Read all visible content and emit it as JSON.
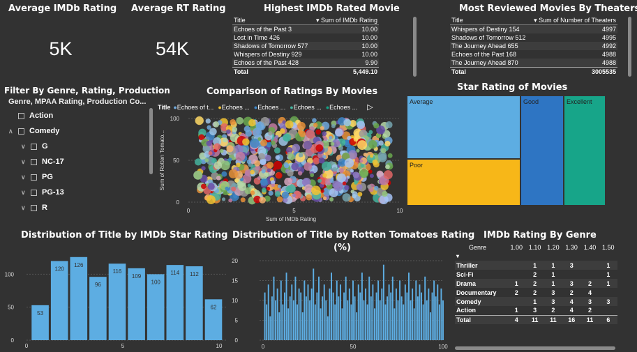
{
  "kpis": {
    "avg_imdb_label": "Average IMDb Rating",
    "avg_imdb_value": "5K",
    "avg_rt_label": "Average RT Rating",
    "avg_rt_value": "54K"
  },
  "highest_table": {
    "title": "Highest IMDb Rated Movie",
    "col_title": "Title",
    "col_value": "Sum of IMDb Rating",
    "rows": [
      [
        "Echoes of the Past 3",
        "10.00"
      ],
      [
        "Lost in Time 426",
        "10.00"
      ],
      [
        "Shadows of Tomorrow 577",
        "10.00"
      ],
      [
        "Whispers of Destiny 929",
        "10.00"
      ],
      [
        "Echoes of the Past 428",
        "9.90"
      ]
    ],
    "total_label": "Total",
    "total_value": "5,449.10"
  },
  "reviewed_table": {
    "title": "Most Reviewed Movies By Theaters",
    "col_title": "Title",
    "col_value": "Sum of Number of Theaters",
    "rows": [
      [
        "Whispers of Destiny 154",
        "4997"
      ],
      [
        "Shadows of Tomorrow 512",
        "4995"
      ],
      [
        "The Journey Ahead 655",
        "4992"
      ],
      [
        "Echoes of the Past 168",
        "4988"
      ],
      [
        "The Journey Ahead 870",
        "4988"
      ]
    ],
    "total_label": "Total",
    "total_value": "3005535"
  },
  "filter": {
    "title": "Filter By Genre, Rating, Production",
    "subtitle": "Genre, MPAA Rating, Production Co...",
    "items": [
      {
        "label": "Action",
        "level": 0
      },
      {
        "label": "Comedy",
        "level": 0
      },
      {
        "label": "G",
        "level": 1
      },
      {
        "label": "NC-17",
        "level": 1
      },
      {
        "label": "PG",
        "level": 1
      },
      {
        "label": "PG-13",
        "level": 1
      },
      {
        "label": "R",
        "level": 1
      }
    ]
  },
  "scatter": {
    "title": "Comparison of Ratings By Movies",
    "legend_label": "Title",
    "legend_items": [
      "Echoes of t...",
      "Echoes ...",
      "Echoes ...",
      "Echoes ...",
      "Echoes ..."
    ],
    "legend_colors": [
      "#6fa8dc",
      "#f1c232",
      "#3d85c6",
      "#45b39d",
      "#16a085"
    ],
    "xlabel": "Sum of IMDb Rating",
    "ylabel": "Sum of Rotten Tomato...",
    "xticks": [
      "0",
      "5",
      "10"
    ],
    "yticks": [
      "0",
      "50",
      "100"
    ]
  },
  "treemap": {
    "title": "Star Rating of Movies",
    "cells": [
      {
        "label": "Average",
        "color": "#5dade2"
      },
      {
        "label": "Poor",
        "color": "#f7b718"
      },
      {
        "label": "Good",
        "color": "#2e75c3"
      },
      {
        "label": "Excellent",
        "color": "#17a589"
      }
    ]
  },
  "imdb_dist": {
    "title": "Distribution of Title by IMDb Star Rating",
    "yticks": [
      "0",
      "50",
      "100"
    ],
    "xticks": [
      "0",
      "5",
      "10"
    ]
  },
  "rt_dist": {
    "title": "Distribution of Title by Rotten Tomatoes Rating",
    "title2": "(%)",
    "yticks": [
      "0",
      "5",
      "10",
      "15",
      "20"
    ],
    "xticks": [
      "0",
      "50",
      "100"
    ]
  },
  "genre_matrix": {
    "title": "IMDb Rating By Genre",
    "columns": [
      "Genre",
      "1.00",
      "1.10",
      "1.20",
      "1.30",
      "1.40",
      "1.50"
    ],
    "rows": [
      [
        "Thriller",
        "",
        "1",
        "1",
        "3",
        "",
        "1"
      ],
      [
        "Sci-Fi",
        "",
        "2",
        "1",
        "",
        "",
        "1"
      ],
      [
        "Drama",
        "1",
        "2",
        "1",
        "3",
        "2",
        "1"
      ],
      [
        "Documentary",
        "2",
        "2",
        "3",
        "2",
        "4",
        ""
      ],
      [
        "Comedy",
        "",
        "1",
        "3",
        "4",
        "3",
        "3"
      ],
      [
        "Action",
        "1",
        "3",
        "2",
        "4",
        "2",
        ""
      ],
      [
        "Total",
        "4",
        "11",
        "11",
        "16",
        "11",
        "6"
      ]
    ]
  },
  "chart_data": [
    {
      "type": "bar",
      "title": "Distribution of Title by IMDb Star Rating",
      "categories": [
        1,
        2,
        3,
        4,
        5,
        6,
        7,
        8,
        9,
        10
      ],
      "values": [
        53,
        120,
        126,
        96,
        116,
        109,
        100,
        114,
        112,
        62
      ],
      "ylim": [
        0,
        130
      ],
      "xlim": [
        0,
        10
      ]
    },
    {
      "type": "bar",
      "title": "Distribution of Title by Rotten Tomatoes Rating (%)",
      "x_start": 1,
      "values": [
        12,
        9,
        14,
        6,
        11,
        16,
        10,
        13,
        7,
        15,
        9,
        12,
        17,
        8,
        11,
        14,
        10,
        16,
        9,
        13,
        12,
        7,
        15,
        11,
        14,
        10,
        13,
        18,
        9,
        12,
        16,
        8,
        11,
        14,
        10,
        6,
        13,
        17,
        12,
        9,
        15,
        11,
        14,
        8,
        12,
        16,
        10,
        13,
        9,
        15,
        11,
        7,
        14,
        12,
        17,
        10,
        13,
        9,
        16,
        11,
        14,
        8,
        12,
        15,
        10,
        13,
        19,
        9,
        11,
        14,
        12,
        16,
        8,
        13,
        10,
        15,
        11,
        9,
        14,
        12,
        17,
        10,
        13,
        8,
        15,
        11,
        14,
        12,
        9,
        16,
        10,
        13,
        7,
        12,
        15,
        11,
        14,
        9,
        13,
        10
      ],
      "ylim": [
        0,
        20
      ],
      "xlim": [
        0,
        100
      ]
    },
    {
      "type": "scatter",
      "title": "Comparison of Ratings By Movies",
      "xlabel": "Sum of IMDb Rating",
      "ylabel": "Sum of Rotten Tomato...",
      "xlim": [
        0,
        10
      ],
      "ylim": [
        0,
        100
      ]
    }
  ]
}
